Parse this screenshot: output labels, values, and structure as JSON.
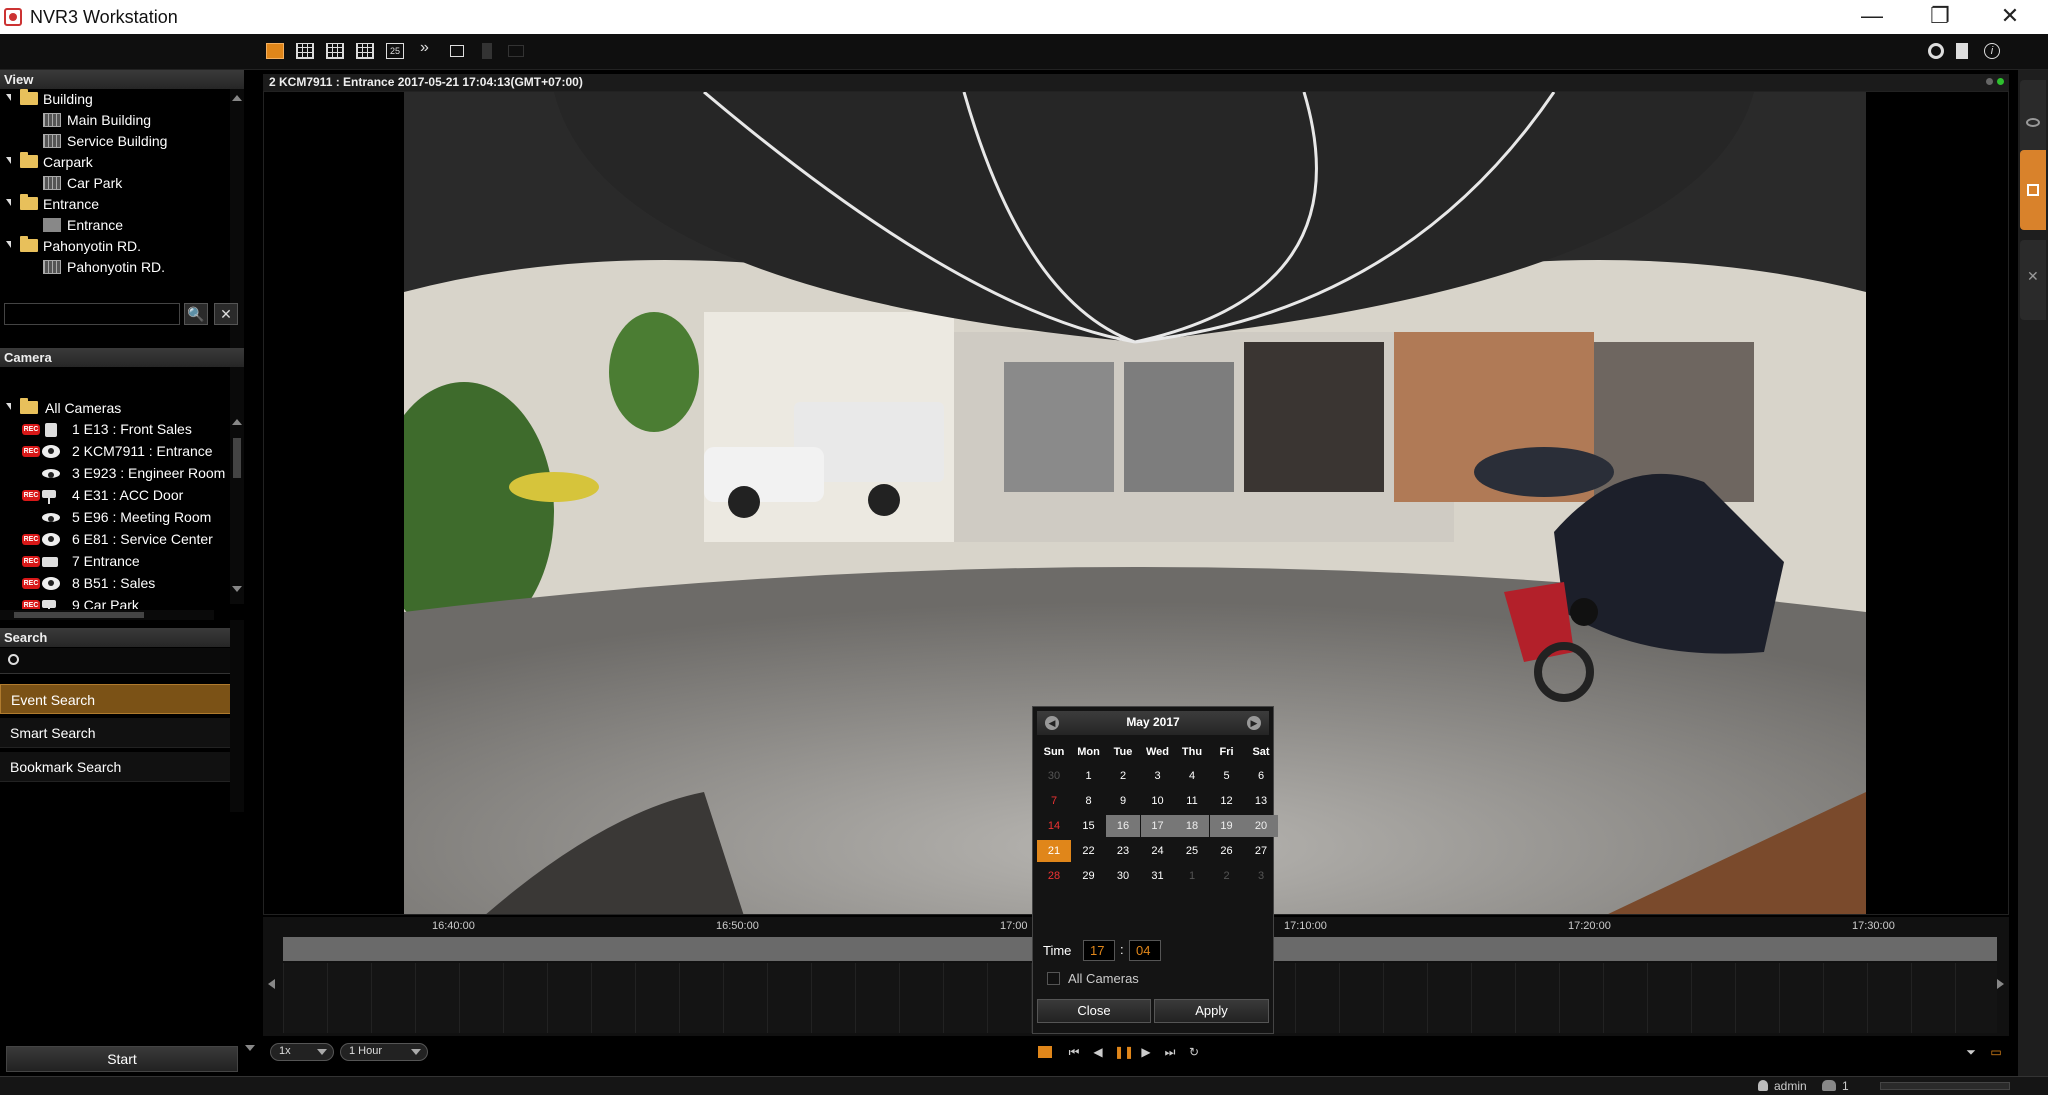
{
  "window": {
    "title": "NVR3 Workstation",
    "minimize": "—",
    "restore": "❐",
    "close": "✕"
  },
  "toolbar": {
    "layout_25": "25",
    "more": "»"
  },
  "view_panel": {
    "title": "View",
    "groups": [
      {
        "label": "Building",
        "children": [
          "Main Building",
          "Service Building"
        ]
      },
      {
        "label": "Carpark",
        "children": [
          "Car Park"
        ]
      },
      {
        "label": "Entrance",
        "children": [
          "Entrance"
        ]
      },
      {
        "label": "Pahonyotin RD.",
        "children": [
          "Pahonyotin RD."
        ]
      }
    ]
  },
  "camera_panel": {
    "title": "Camera",
    "search_placeholder": "",
    "search_button": "🔍",
    "clear_button": "✕",
    "root": "All Cameras",
    "rec_badge": "REC",
    "cameras": [
      {
        "label": "1 E13 : Front Sales",
        "rec": true,
        "icon": "ptz"
      },
      {
        "label": "2 KCM7911 : Entrance",
        "rec": true,
        "icon": "dome"
      },
      {
        "label": "3 E923 : Engineer Room",
        "rec": false,
        "icon": "fisheye"
      },
      {
        "label": "4 E31 : ACC Door",
        "rec": true,
        "icon": "bullet"
      },
      {
        "label": "5 E96 : Meeting Room",
        "rec": false,
        "icon": "fisheye"
      },
      {
        "label": "6 E81 : Service Center",
        "rec": true,
        "icon": "dome"
      },
      {
        "label": "7 Entrance",
        "rec": true,
        "icon": "box"
      },
      {
        "label": "8 B51 : Sales",
        "rec": true,
        "icon": "dome"
      },
      {
        "label": "9 Car Park",
        "rec": true,
        "icon": "bullet"
      }
    ]
  },
  "search_panel": {
    "title": "Search",
    "items": [
      "Event Search",
      "Smart Search",
      "Bookmark Search"
    ],
    "active": "Event Search"
  },
  "start_button": "Start",
  "video": {
    "header": "2 KCM7911 : Entrance   2017-05-21 17:04:13(GMT+07:00)"
  },
  "timeline": {
    "ticks": [
      "16:40:00",
      "16:50:00",
      "17:00",
      "17:10:00",
      "17:20:00",
      "17:30:00"
    ]
  },
  "controls": {
    "speed": "1x",
    "range": "1 Hour"
  },
  "status": {
    "user": "admin",
    "count": "1"
  },
  "calendar": {
    "title": "May 2017",
    "weekdays": [
      "Sun",
      "Mon",
      "Tue",
      "Wed",
      "Thu",
      "Fri",
      "Sat"
    ],
    "weeks": [
      [
        "30",
        "1",
        "2",
        "3",
        "4",
        "5",
        "6"
      ],
      [
        "7",
        "8",
        "9",
        "10",
        "11",
        "12",
        "13"
      ],
      [
        "14",
        "15",
        "16",
        "17",
        "18",
        "19",
        "20"
      ],
      [
        "21",
        "22",
        "23",
        "24",
        "25",
        "26",
        "27"
      ],
      [
        "28",
        "29",
        "30",
        "31",
        "1",
        "2",
        "3"
      ]
    ],
    "selected_day": "21",
    "range_days": [
      "16",
      "17",
      "18",
      "19",
      "20"
    ],
    "time_label": "Time",
    "hour": "17",
    "minute": "04",
    "all_cameras_label": "All Cameras",
    "close_label": "Close",
    "apply_label": "Apply"
  },
  "colors": {
    "accent": "#e0861a",
    "rec": "#d81818",
    "active_menu": "#7b5216"
  }
}
